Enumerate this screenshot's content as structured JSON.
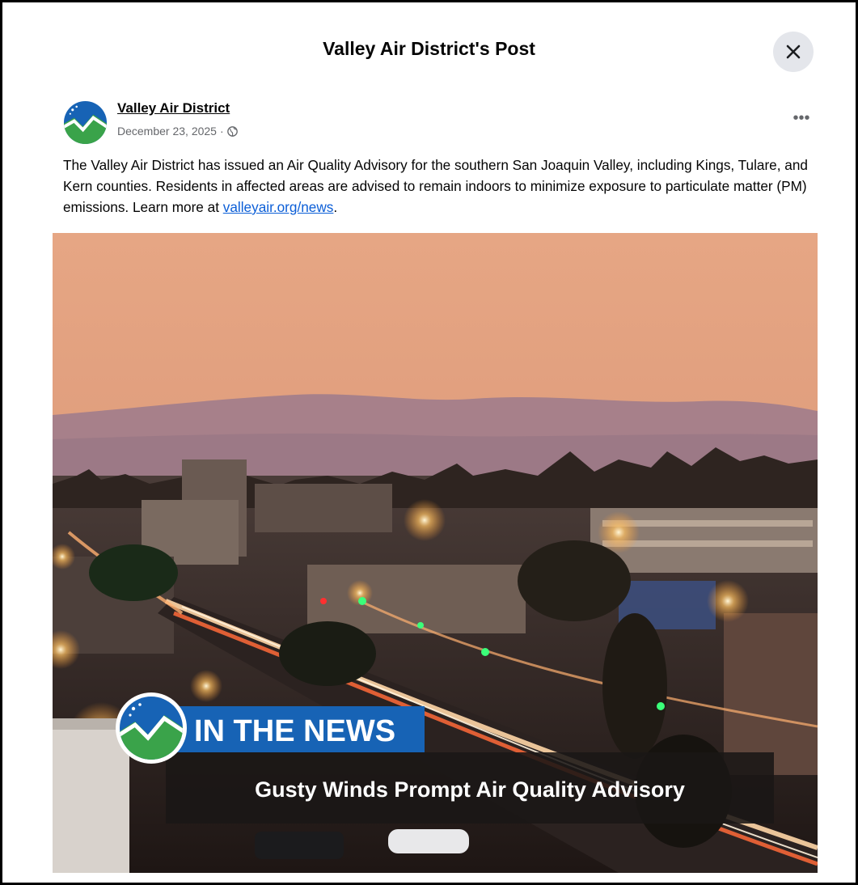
{
  "dialog": {
    "title": "Valley Air District's Post"
  },
  "post": {
    "author": "Valley Air District",
    "date": "December 23, 2025",
    "separator": "·",
    "text_before_link": "The Valley Air District has issued an Air Quality Advisory for the southern San Joaquin Valley, including Kings, Tulare, and Kern counties. Residents in affected areas are advised to remain indoors to minimize exposure to particulate matter (PM) emissions. Learn more at ",
    "link_text": "valleyair.org/news",
    "text_after_link": ".",
    "more_label": "•••"
  },
  "image": {
    "banner_label": "IN THE NEWS",
    "headline": "Gusty Winds Prompt Air Quality Advisory"
  },
  "colors": {
    "brand_blue": "#1763b5",
    "brand_green": "#3aa34a",
    "link": "#0b5ed7",
    "sky_top": "#e8a885",
    "sky_bottom": "#d68d79"
  },
  "icons": {
    "close": "close-icon",
    "globe": "globe-icon",
    "more": "more-options-icon",
    "logo": "valley-air-logo"
  }
}
